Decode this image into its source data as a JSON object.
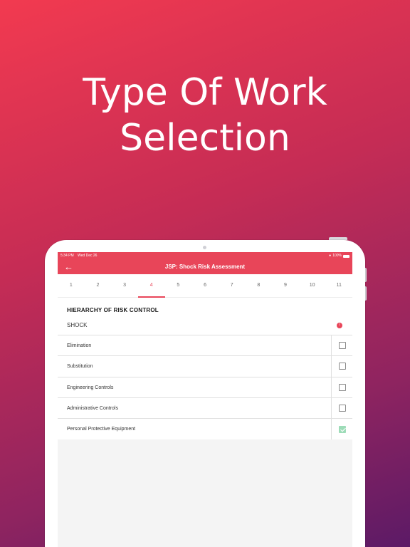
{
  "headline": {
    "line1": "Type Of Work",
    "line2": "Selection"
  },
  "status_bar": {
    "time": "5:34 PM",
    "date": "Wed Dec 26",
    "battery": "100%"
  },
  "header": {
    "back_icon": "arrow-left-icon",
    "title": "JSP: Shock Risk Assessment"
  },
  "steps": [
    "1",
    "2",
    "3",
    "4",
    "5",
    "6",
    "7",
    "8",
    "9",
    "10",
    "11"
  ],
  "active_step": "4",
  "section": {
    "title": "HIERARCHY OF RISK CONTROL",
    "hazard": "SHOCK",
    "hazard_badge": "!"
  },
  "controls": [
    {
      "label": "Elimination",
      "checked": false
    },
    {
      "label": "Substitution",
      "checked": false
    },
    {
      "label": "Engineering Controls",
      "checked": false
    },
    {
      "label": "Administrative Controls",
      "checked": false
    },
    {
      "label": "Personal Protective Equipment",
      "checked": true
    }
  ],
  "colors": {
    "accent": "#e84559",
    "check": "#9ddcb8"
  }
}
